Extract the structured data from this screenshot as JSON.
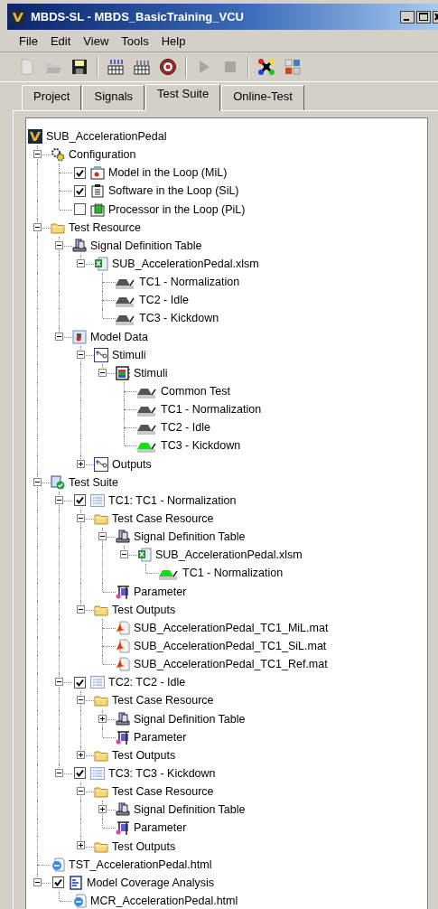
{
  "window": {
    "title": "MBDS-SL - MBDS_BasicTraining_VCU"
  },
  "menu": [
    "File",
    "Edit",
    "View",
    "Tools",
    "Help"
  ],
  "tabs": [
    {
      "label": "Project",
      "selected": false
    },
    {
      "label": "Signals",
      "selected": false
    },
    {
      "label": "Test Suite",
      "selected": true
    },
    {
      "label": "Online-Test",
      "selected": false
    }
  ],
  "tree": {
    "label": "SUB_AccelerationPedal",
    "kind": "logo",
    "children": [
      {
        "label": "Configuration",
        "kind": "gears",
        "expanded": true,
        "children": [
          {
            "label": "Model in the Loop (MiL)",
            "kind": "model",
            "checked": true
          },
          {
            "label": "Software in the Loop (SiL)",
            "kind": "software",
            "checked": true
          },
          {
            "label": "Processor in the Loop (PiL)",
            "kind": "processor",
            "checked": false
          }
        ]
      },
      {
        "label": "Test Resource",
        "kind": "folder",
        "expanded": true,
        "children": [
          {
            "label": "Signal Definition Table",
            "kind": "sdt",
            "expanded": true,
            "children": [
              {
                "label": "SUB_AccelerationPedal.xlsm",
                "kind": "excel",
                "expanded": true,
                "children": [
                  {
                    "label": "TC1 - Normalization",
                    "kind": "signal"
                  },
                  {
                    "label": "TC2 - Idle",
                    "kind": "signal"
                  },
                  {
                    "label": "TC3 - Kickdown",
                    "kind": "signal"
                  }
                ]
              }
            ]
          },
          {
            "label": "Model Data",
            "kind": "modeldata",
            "expanded": true,
            "children": [
              {
                "label": "Stimuli",
                "kind": "block",
                "expanded": true,
                "children": [
                  {
                    "label": "Stimuli",
                    "kind": "stimuli",
                    "expanded": true,
                    "children": [
                      {
                        "label": "Common Test",
                        "kind": "signal"
                      },
                      {
                        "label": "TC1 - Normalization",
                        "kind": "signal"
                      },
                      {
                        "label": "TC2 - Idle",
                        "kind": "signal"
                      },
                      {
                        "label": "TC3 - Kickdown",
                        "kind": "signal-active"
                      }
                    ]
                  }
                ]
              },
              {
                "label": "Outputs",
                "kind": "block",
                "expanded": false
              }
            ]
          }
        ]
      },
      {
        "label": "Test Suite",
        "kind": "testsuite",
        "expanded": true,
        "children": [
          {
            "label": "TC1: TC1 - Normalization",
            "kind": "testcase",
            "expanded": true,
            "checked": true,
            "children": [
              {
                "label": "Test Case Resource",
                "kind": "folder",
                "expanded": true,
                "children": [
                  {
                    "label": "Signal Definition Table",
                    "kind": "sdt",
                    "expanded": true,
                    "children": [
                      {
                        "label": "SUB_AccelerationPedal.xlsm",
                        "kind": "excel",
                        "expanded": true,
                        "children": [
                          {
                            "label": "TC1 - Normalization",
                            "kind": "signal-active"
                          }
                        ]
                      }
                    ]
                  },
                  {
                    "label": "Parameter",
                    "kind": "parameter"
                  }
                ]
              },
              {
                "label": "Test Outputs",
                "kind": "folder",
                "expanded": true,
                "children": [
                  {
                    "label": "SUB_AccelerationPedal_TC1_MiL.mat",
                    "kind": "matfile"
                  },
                  {
                    "label": "SUB_AccelerationPedal_TC1_SiL.mat",
                    "kind": "matfile"
                  },
                  {
                    "label": "SUB_AccelerationPedal_TC1_Ref.mat",
                    "kind": "matfile"
                  }
                ]
              }
            ]
          },
          {
            "label": "TC2: TC2 - Idle",
            "kind": "testcase",
            "expanded": true,
            "checked": true,
            "children": [
              {
                "label": "Test Case Resource",
                "kind": "folder",
                "expanded": true,
                "children": [
                  {
                    "label": "Signal Definition Table",
                    "kind": "sdt",
                    "expanded": false
                  },
                  {
                    "label": "Parameter",
                    "kind": "parameter"
                  }
                ]
              },
              {
                "label": "Test Outputs",
                "kind": "folder",
                "expanded": false
              }
            ]
          },
          {
            "label": "TC3: TC3 - Kickdown",
            "kind": "testcase",
            "expanded": true,
            "checked": true,
            "children": [
              {
                "label": "Test Case Resource",
                "kind": "folder",
                "expanded": true,
                "children": [
                  {
                    "label": "Signal Definition Table",
                    "kind": "sdt",
                    "expanded": false
                  },
                  {
                    "label": "Parameter",
                    "kind": "parameter"
                  }
                ]
              },
              {
                "label": "Test Outputs",
                "kind": "folder",
                "expanded": false
              }
            ]
          }
        ]
      },
      {
        "label": "TST_AccelerationPedal.html",
        "kind": "html"
      },
      {
        "label": "Model Coverage Analysis",
        "kind": "coverage",
        "expanded": true,
        "checked": true,
        "children": [
          {
            "label": "MCR_AccelerationPedal.html",
            "kind": "html"
          }
        ]
      }
    ]
  }
}
